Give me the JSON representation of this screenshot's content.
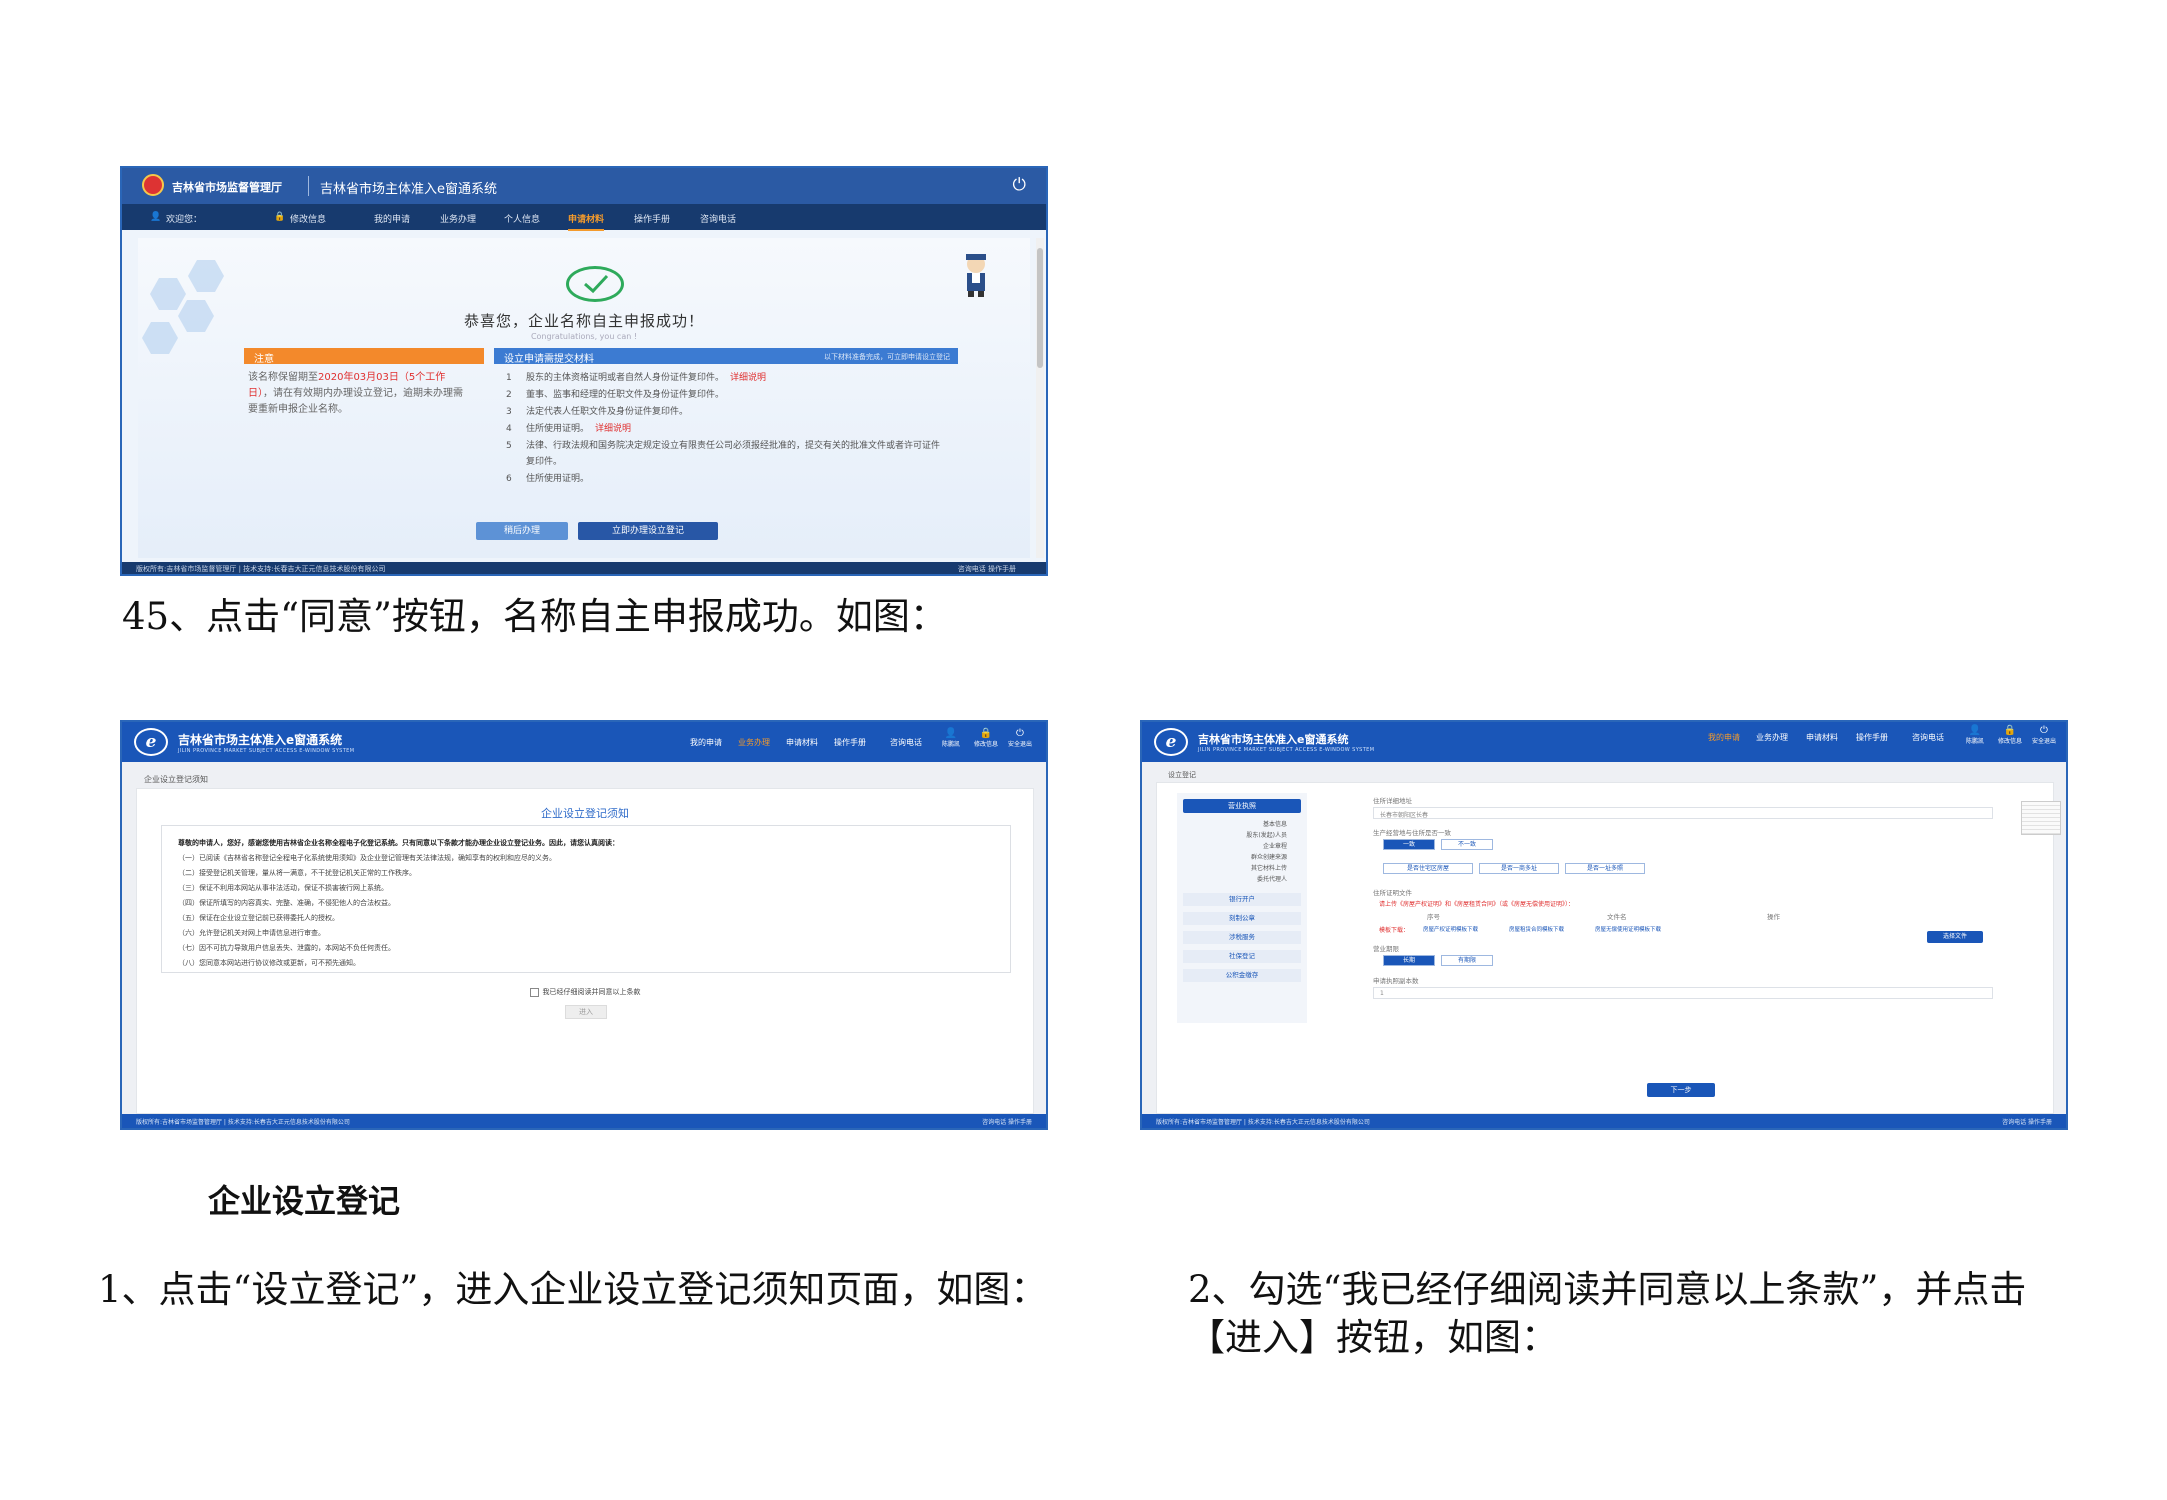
{
  "shot1": {
    "org": "吉林省市场监督管理厅",
    "system": "吉林省市场主体准入e窗通系统",
    "nav": [
      "欢迎您：",
      "修改信息",
      "我的申请",
      "业务办理",
      "个人信息",
      "申请材料",
      "操作手册",
      "咨询电话"
    ],
    "congrats": "恭喜您，企业名称自主申报成功！",
    "congrats_en": "Congratulations, you can !",
    "notice_title": "注意",
    "notice_pre": "该名称保留期至",
    "notice_date": "2020年03月03日（5个工作日）",
    "notice_post": "，请在有效期内办理设立登记，逾期未办理需要重新申报企业名称。",
    "materials_title": "设立申请需提交材料",
    "materials_hint": "以下材料准备完成，可立即申请设立登记",
    "materials": [
      {
        "n": "1",
        "text": "股东的主体资格证明或者自然人身份证件复印件。",
        "link": "详细说明"
      },
      {
        "n": "2",
        "text": "董事、监事和经理的任职文件及身份证件复印件。",
        "link": ""
      },
      {
        "n": "3",
        "text": "法定代表人任职文件及身份证件复印件。",
        "link": ""
      },
      {
        "n": "4",
        "text": "住所使用证明。",
        "link": "详细说明"
      },
      {
        "n": "5",
        "text": "法律、行政法规和国务院决定规定设立有限责任公司必须报经批准的，提交有关的批准文件或者许可证件复印件。",
        "link": ""
      },
      {
        "n": "6",
        "text": "住所使用证明。",
        "link": ""
      }
    ],
    "btn_later": "稍后办理",
    "btn_now": "立即办理设立登记",
    "footer_left": "版权所有:吉林省市场监督管理厅 | 技术支持:长春吉大正元信息技术股份有限公司",
    "footer_right": "咨询电话  操作手册"
  },
  "caption1": "45、点击“同意”按钮，名称自主申报成功。如图：",
  "shot2": {
    "logo": "e",
    "title": "吉林省市场主体准入e窗通系统",
    "subtitle": "JILIN PROVINCE MARKET SUBJECT ACCESS E-WINDOW SYSTEM",
    "nav": [
      "我的申请",
      "业务办理",
      "申请材料",
      "操作手册",
      "咨询电话"
    ],
    "icons": [
      "陈鹏凯",
      "修改信息",
      "安全退出"
    ],
    "crumb": "企业设立登记须知",
    "panel_title": "企业设立登记须知",
    "lead": "尊敬的申请人，您好，感谢您使用吉林省企业名称全程电子化登记系统。只有同意以下条款才能办理企业设立登记业务。因此，请您认真阅读：",
    "terms": [
      "（一）已阅读《吉林省名称登记全程电子化系统使用须知》及企业登记管理有关法律法规，确知享有的权利和应尽的义务。",
      "（二）接受登记机关管理，量从将一满意，不干扰登记机关正常的工作秩序。",
      "（三）保证不利用本网站从事非法活动，保证不损害被行网上系统。",
      "（四）保证所填写的内容真实、完整、准确，不侵犯他人的合法权益。",
      "（五）保证在企业设立登记前已获得委托人的授权。",
      "（六）允许登记机关对网上申请信息进行审查。",
      "（七）因不可抗力导致用户信息丢失、泄露的，本网站不负任何责任。",
      "（八）您同意本网站进行协议修改或更新，可不预先通知。"
    ],
    "agree": "我已经仔细阅读并同意以上条款",
    "enter": "进入",
    "footer_left": "版权所有:吉林省市场监督管理厅 | 技术支持:长春吉大正元信息技术股份有限公司",
    "footer_right": "咨询电话  操作手册"
  },
  "shot3": {
    "logo": "e",
    "title": "吉林省市场主体准入e窗通系统",
    "subtitle": "JILIN PROVINCE MARKET SUBJECT ACCESS E-WINDOW SYSTEM",
    "nav": [
      "我的申请",
      "业务办理",
      "申请材料",
      "操作手册",
      "咨询电话"
    ],
    "icons": [
      "陈鹏凯",
      "修改信息",
      "安全退出"
    ],
    "crumb": "设立登记",
    "side_main": "营业执照",
    "side_subs": [
      "基本信息",
      "股东(发起)人员",
      "企业章程",
      "群众创建来源",
      "其它材料上传",
      "委托代理人"
    ],
    "side_groups": [
      "银行开户",
      "刻制公章",
      "涉税服务",
      "社保登记",
      "公积金缴存"
    ],
    "label_addr": "住所详细地址",
    "addr_value": "长春市朝阳区长春",
    "label_same": "生产经营地与住所是否一致",
    "seg_yes": "一致",
    "seg_no": "不一致",
    "seg_row": [
      "是否住宅区房屋",
      "是否一商多址",
      "是否一址多照"
    ],
    "label_proof": "住所证明文件",
    "proof_red": "请上传《房屋产权证明》和《房屋租赁合同》（或《房屋无偿使用证明》）：",
    "col_headers": [
      "序号",
      "文件名",
      "操作"
    ],
    "upload": "选择文件",
    "links": [
      "模板下载：",
      "房屋产权证明模板下载",
      "房屋租赁合同模板下载",
      "房屋无偿使用证明模板下载"
    ],
    "label_public": "营业期限",
    "seg_long": "长期",
    "seg_fixed": "有期限",
    "label_copies": "申请执照副本数",
    "copies_value": "1",
    "next": "下一步",
    "footer_left": "版权所有:吉林省市场监督管理厅 | 技术支持:长春吉大正元信息技术股份有限公司",
    "footer_right": "咨询电话  操作手册"
  },
  "heading": "企业设立登记",
  "caption2": "1、点击“设立登记”，进入企业设立登记须知页面，如图：",
  "caption3": "2、勾选“我已经仔细阅读并同意以上条款”，并点击【进入】按钮，如图："
}
